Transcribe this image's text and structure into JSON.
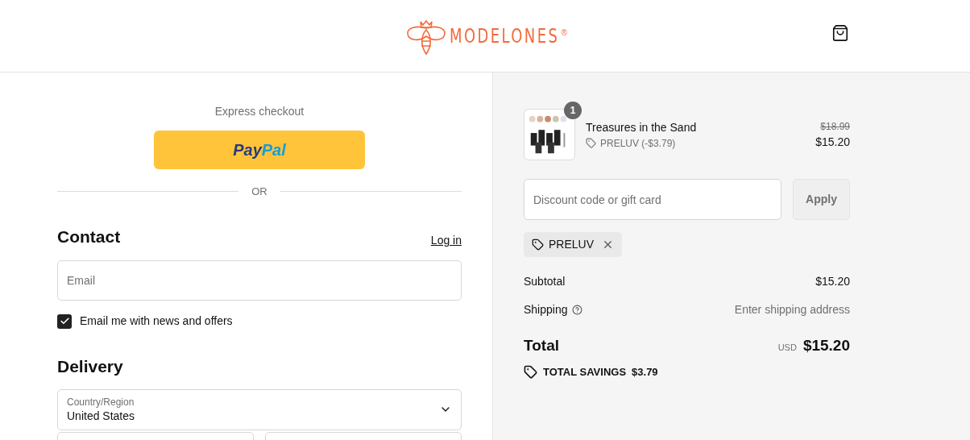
{
  "header": {
    "brand": "MODELONES",
    "brand_mark": "®"
  },
  "express": {
    "title": "Express checkout",
    "paypal": [
      "Pay",
      "Pal"
    ],
    "divider": "OR"
  },
  "contact": {
    "heading": "Contact",
    "login": "Log in",
    "email_placeholder": "Email",
    "news": {
      "label": "Email me with news and offers",
      "checked": true
    }
  },
  "delivery": {
    "heading": "Delivery",
    "country": {
      "label": "Country/Region",
      "value": "United States"
    }
  },
  "summary": {
    "item": {
      "name": "Treasures in the Sand",
      "quantity": "1",
      "discount": "PRELUV (-$3.79)",
      "old_price": "$18.99",
      "price": "$15.20"
    },
    "discount_placeholder": "Discount code or gift card",
    "apply": "Apply",
    "applied_code": "PRELUV",
    "subtotal": {
      "label": "Subtotal",
      "value": "$15.20"
    },
    "shipping": {
      "label": "Shipping",
      "value": "Enter shipping address"
    },
    "total": {
      "label": "Total",
      "currency": "USD",
      "value": "$15.20"
    },
    "savings": {
      "label": "TOTAL SAVINGS",
      "value": "$3.79"
    }
  }
}
